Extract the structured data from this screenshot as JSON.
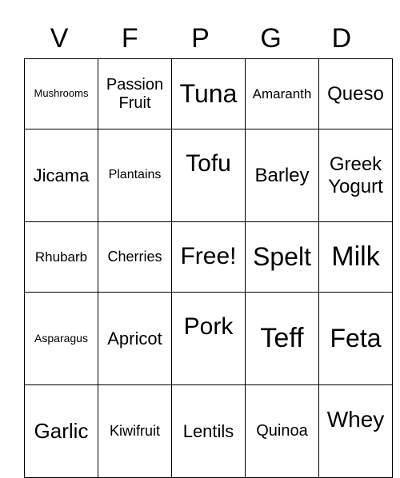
{
  "header": [
    "V",
    "F",
    "P",
    "G",
    "D"
  ],
  "rows": [
    [
      {
        "text": "Mushrooms",
        "size": 13
      },
      {
        "text": "Passion Fruit",
        "size": 20
      },
      {
        "text": "Tuna",
        "size": 32
      },
      {
        "text": "Amaranth",
        "size": 17
      },
      {
        "text": "Queso",
        "size": 24
      }
    ],
    [
      {
        "text": "Jicama",
        "size": 22
      },
      {
        "text": "Plantains",
        "size": 16
      },
      {
        "text": "Tofu",
        "size": 30,
        "up": true
      },
      {
        "text": "Barley",
        "size": 24
      },
      {
        "text": "Greek Yogurt",
        "size": 24
      }
    ],
    [
      {
        "text": "Rhubarb",
        "size": 17
      },
      {
        "text": "Cherries",
        "size": 18
      },
      {
        "text": "Free!",
        "size": 30
      },
      {
        "text": "Spelt",
        "size": 32
      },
      {
        "text": "Milk",
        "size": 34
      }
    ],
    [
      {
        "text": "Asparagus",
        "size": 14
      },
      {
        "text": "Apricot",
        "size": 22
      },
      {
        "text": "Pork",
        "size": 30,
        "up": true
      },
      {
        "text": "Teff",
        "size": 34
      },
      {
        "text": "Feta",
        "size": 32
      }
    ],
    [
      {
        "text": "Garlic",
        "size": 26
      },
      {
        "text": "Kiwifruit",
        "size": 18
      },
      {
        "text": "Lentils",
        "size": 22
      },
      {
        "text": "Quinoa",
        "size": 20
      },
      {
        "text": "Whey",
        "size": 28,
        "up": true
      }
    ]
  ]
}
